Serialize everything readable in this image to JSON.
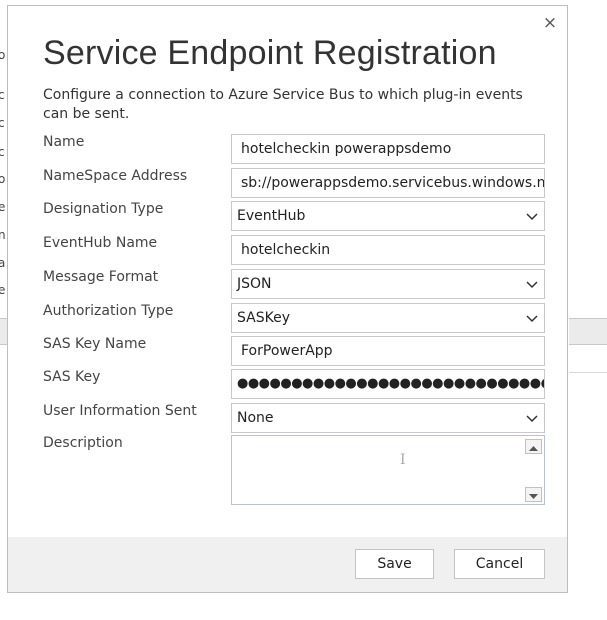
{
  "dialog": {
    "title": "Service Endpoint Registration",
    "subtitle": "Configure a connection to Azure Service Bus to which plug-in events can be sent.",
    "close_glyph": "×"
  },
  "fields": {
    "name": {
      "label": "Name",
      "value": "hotelcheckin powerappsdemo"
    },
    "namespace": {
      "label": "NameSpace Address",
      "value": "sb://powerappsdemo.servicebus.windows.net/"
    },
    "designation": {
      "label": "Designation Type",
      "value": "EventHub"
    },
    "eventhub": {
      "label": "EventHub Name",
      "value": "hotelcheckin"
    },
    "format": {
      "label": "Message Format",
      "value": "JSON"
    },
    "auth": {
      "label": "Authorization Type",
      "value": "SASKey"
    },
    "saskeyname": {
      "label": "SAS Key Name",
      "value": "ForPowerApp"
    },
    "saskey": {
      "label": "SAS Key",
      "value": "●●●●●●●●●●●●●●●●●●●●●●●●●●●●●●●●●●●●●●"
    },
    "userinfo": {
      "label": "User Information Sent",
      "value": "None"
    },
    "description": {
      "label": "Description",
      "value": ""
    }
  },
  "buttons": {
    "save": "Save",
    "cancel": "Cancel"
  },
  "background": {
    "left_letters": [
      "o",
      "c",
      "c",
      "c",
      "o",
      "e",
      "n",
      "a",
      "e"
    ]
  }
}
